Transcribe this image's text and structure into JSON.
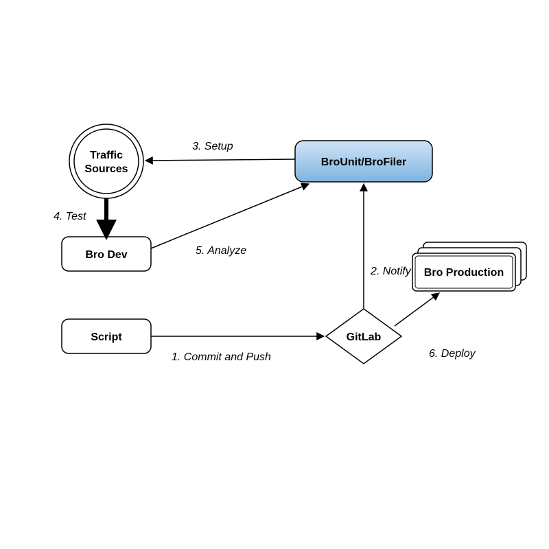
{
  "nodes": {
    "traffic": {
      "line1": "Traffic",
      "line2": "Sources"
    },
    "broDev": {
      "label": "Bro Dev"
    },
    "script": {
      "label": "Script"
    },
    "broUnit": {
      "label": "BroUnit/BroFiler"
    },
    "gitlab": {
      "label": "GitLab"
    },
    "broProd": {
      "label": "Bro Production"
    }
  },
  "edges": {
    "commit": {
      "label": "1. Commit and Push"
    },
    "notify": {
      "label": "2. Notify"
    },
    "setup": {
      "label": "3. Setup"
    },
    "test": {
      "label": "4. Test"
    },
    "analyze": {
      "label": "5. Analyze"
    },
    "deploy": {
      "label": "6. Deploy"
    }
  },
  "colors": {
    "highlightFillTop": "#cfe4f7",
    "highlightFillBottom": "#7fb3e0"
  }
}
